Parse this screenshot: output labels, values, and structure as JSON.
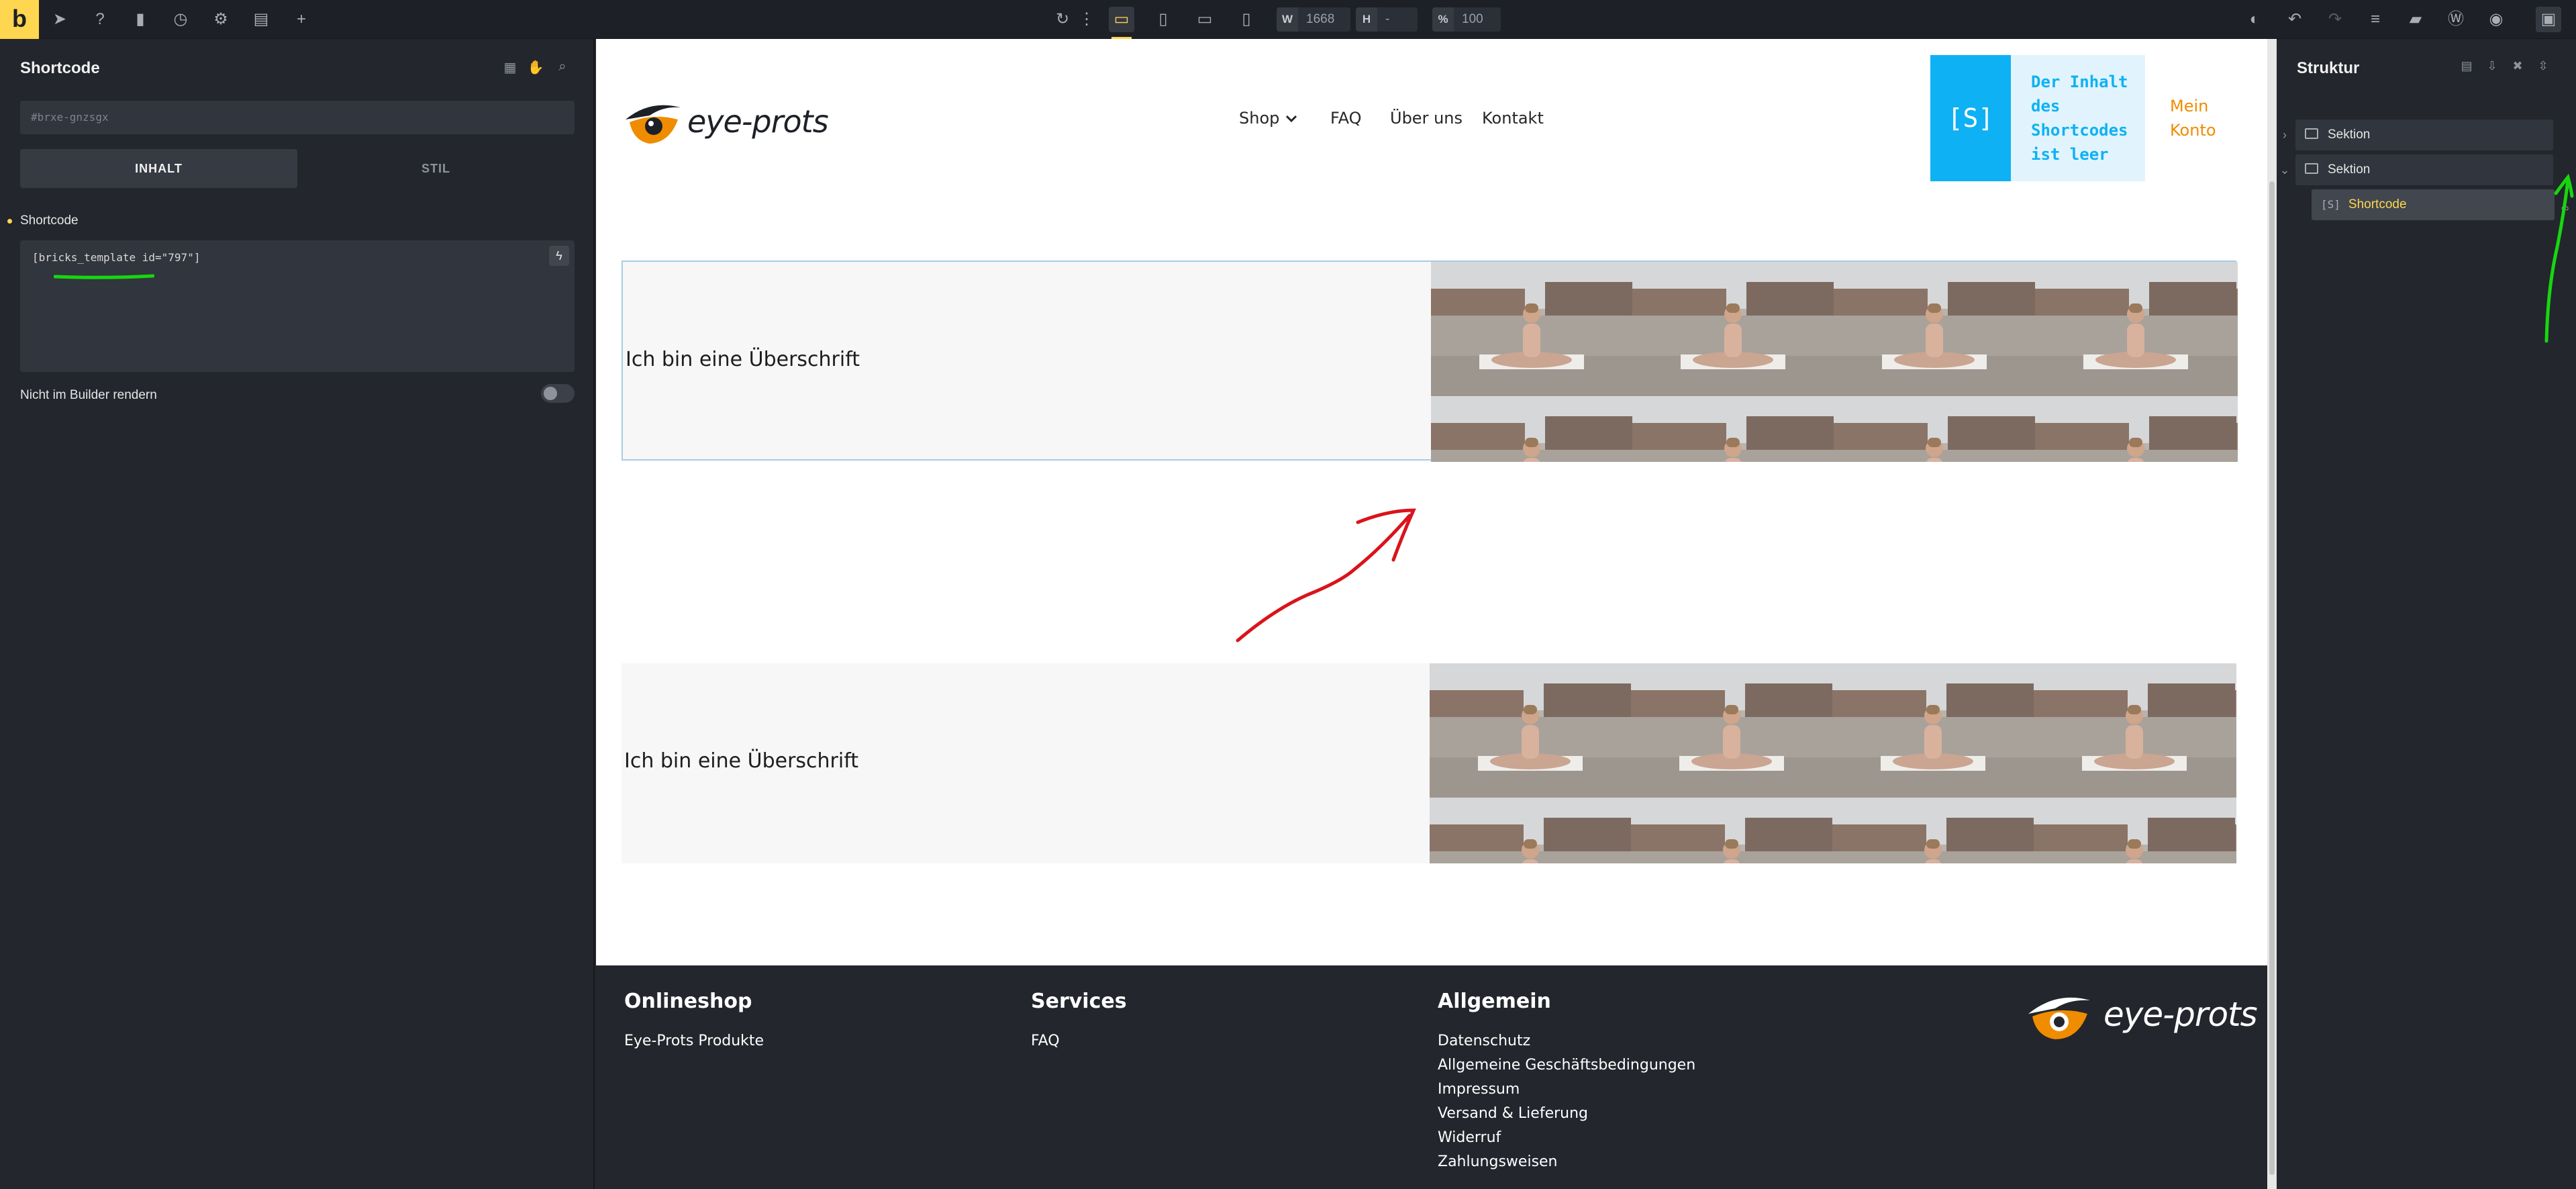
{
  "app": {
    "logo_letter": "b"
  },
  "toolbar": {
    "width_label": "W",
    "width_value": "1668",
    "height_label": "H",
    "height_value": "-",
    "zoom_label": "%",
    "zoom_value": "100"
  },
  "left_panel": {
    "title": "Shortcode",
    "css_id": "#brxe-gnzsgx",
    "tab_content": "INHALT",
    "tab_style": "STIL",
    "shortcode_label": "Shortcode",
    "shortcode_value": "[bricks_template id=\"797\"]",
    "render_label": "Nicht im Builder rendern",
    "render_toggle_on": false
  },
  "site": {
    "logo_text": "eye-prots",
    "nav": [
      "Shop",
      "FAQ",
      "Über uns",
      "Kontakt"
    ],
    "shortcode_placeholder_icon": "[S]",
    "shortcode_placeholder_text": "Der Inhalt des Shortcodes ist leer",
    "account_link": "Mein Konto",
    "sections": [
      {
        "heading": "Ich bin eine Überschrift"
      },
      {
        "heading": "Ich bin eine Überschrift"
      }
    ],
    "footer": {
      "col1": {
        "heading": "Onlineshop",
        "links": [
          "Eye-Prots Produkte"
        ]
      },
      "col2": {
        "heading": "Services",
        "links": [
          "FAQ"
        ]
      },
      "col3": {
        "heading": "Allgemein",
        "links": [
          "Datenschutz",
          "Allgemeine Geschäftsbedingungen",
          "Impressum",
          "Versand & Lieferung",
          "Widerruf",
          "Zahlungsweisen"
        ]
      },
      "logo_text": "eye-prots"
    }
  },
  "right_panel": {
    "title": "Struktur",
    "tree": [
      {
        "label": "Sektion",
        "icon": "section-icon",
        "expanded": false
      },
      {
        "label": "Sektion",
        "icon": "section-icon",
        "expanded": true
      },
      {
        "label": "Shortcode",
        "icon": "shortcode-icon",
        "selected": true
      }
    ]
  },
  "colors": {
    "accent_yellow": "#ffd64f",
    "shortcode_blue": "#0eb1f3",
    "account_orange": "#f08c00",
    "annotation_red": "#d9141b",
    "annotation_green": "#17d610",
    "panel_bg": "#23262d"
  }
}
